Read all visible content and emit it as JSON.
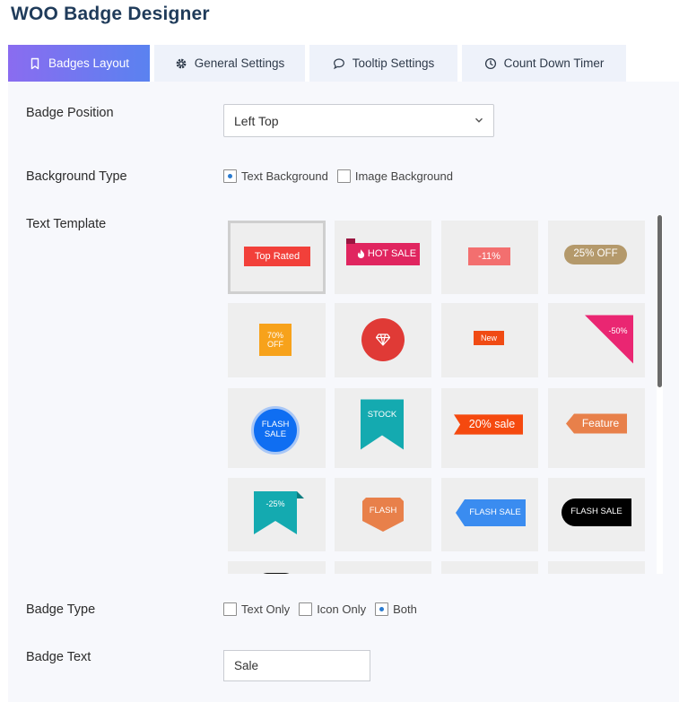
{
  "app": {
    "title": "WOO Badge Designer"
  },
  "tabs": [
    {
      "label": "Badges Layout",
      "icon": "bookmark-icon",
      "active": true
    },
    {
      "label": "General Settings",
      "icon": "gear-icon",
      "active": false
    },
    {
      "label": "Tooltip Settings",
      "icon": "chat-bubble-icon",
      "active": false
    },
    {
      "label": "Count Down Timer",
      "icon": "clock-icon",
      "active": false
    }
  ],
  "badge_position": {
    "label": "Badge Position",
    "value": "Left Top"
  },
  "background_type": {
    "label": "Background Type",
    "options": [
      {
        "label": "Text Background",
        "checked": true
      },
      {
        "label": "Image Background",
        "checked": false
      }
    ]
  },
  "text_template": {
    "label": "Text Template",
    "badges": [
      "Top Rated",
      "HOT SALE",
      "-11%",
      "25% OFF",
      "70%",
      "OFF",
      "New",
      "-50%",
      "FLASH",
      "SALE",
      "STOCK",
      "20% sale",
      "Feature",
      "-25%",
      "FLASH",
      "FLASH SALE",
      "FLASH SALE"
    ]
  },
  "badge_type": {
    "label": "Badge Type",
    "options": [
      {
        "label": "Text Only",
        "checked": false
      },
      {
        "label": "Icon Only",
        "checked": false
      },
      {
        "label": "Both",
        "checked": true
      }
    ]
  },
  "badge_text": {
    "label": "Badge Text",
    "value": "Sale"
  },
  "colors": {
    "accent_start": "#8a6cf0",
    "accent_end": "#5a82f0",
    "radio_dot": "#2a7bd0"
  }
}
